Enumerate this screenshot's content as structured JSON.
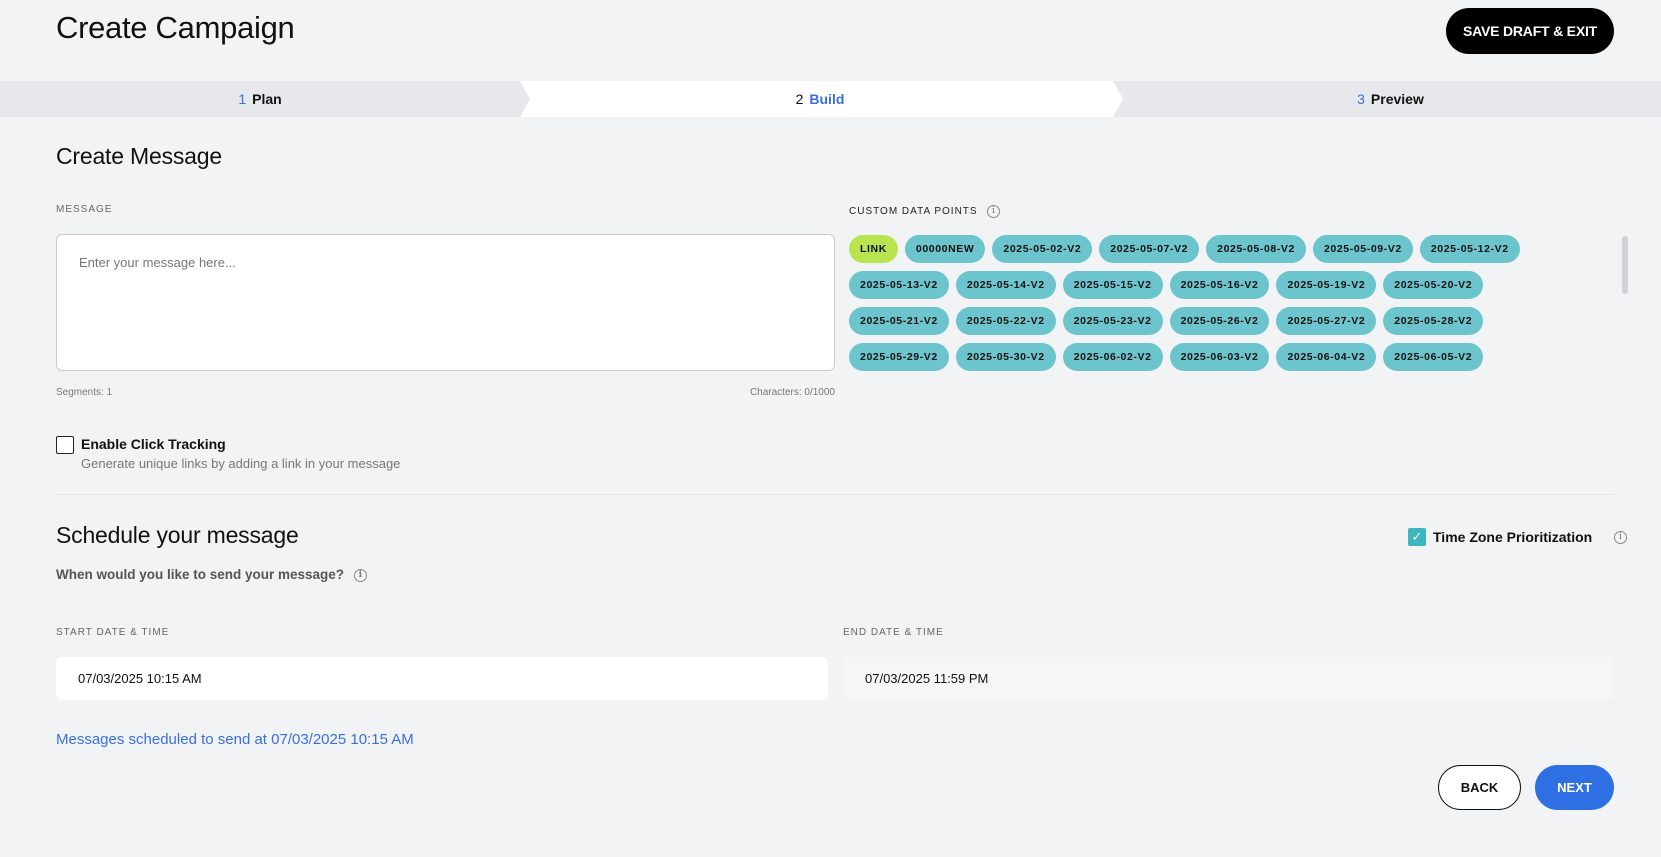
{
  "header": {
    "title": "Create Campaign",
    "save_label": "SAVE DRAFT & EXIT"
  },
  "stepper": {
    "steps": [
      {
        "num": "1",
        "label": "Plan"
      },
      {
        "num": "2",
        "label": "Build"
      },
      {
        "num": "3",
        "label": "Preview"
      }
    ],
    "active": "Build"
  },
  "message": {
    "section_title": "Create Message",
    "label": "MESSAGE",
    "placeholder": "Enter your message here...",
    "segments": "Segments: 1",
    "characters": "Characters: 0/1000"
  },
  "custom_data_points": {
    "label": "CUSTOM DATA POINTS",
    "rows": [
      [
        "LINK",
        "00000NEW",
        "2025-05-02-V2",
        "2025-05-07-V2",
        "2025-05-08-V2",
        "2025-05-09-V2",
        "2025-05-12-V2"
      ],
      [
        "2025-05-13-V2",
        "2025-05-14-V2",
        "2025-05-15-V2",
        "2025-05-16-V2",
        "2025-05-19-V2",
        "2025-05-20-V2"
      ],
      [
        "2025-05-21-V2",
        "2025-05-22-V2",
        "2025-05-23-V2",
        "2025-05-26-V2",
        "2025-05-27-V2",
        "2025-05-28-V2"
      ],
      [
        "2025-05-29-V2",
        "2025-05-30-V2",
        "2025-06-02-V2",
        "2025-06-03-V2",
        "2025-06-04-V2",
        "2025-06-05-V2"
      ]
    ]
  },
  "click_tracking": {
    "checked": false,
    "title": "Enable Click Tracking",
    "subtitle": "Generate unique links by adding a link in your message"
  },
  "schedule": {
    "section_title": "Schedule your message",
    "question": "When would you like to send your message?",
    "tz_label": "Time Zone Prioritization",
    "tz_checked": true,
    "start_label": "START DATE & TIME",
    "start_value": "07/03/2025 10:15 AM",
    "end_label": "END DATE & TIME",
    "end_value": "07/03/2025 11:59 PM",
    "note": "Messages scheduled to send at 07/03/2025 10:15 AM"
  },
  "footer": {
    "back_label": "BACK",
    "next_label": "NEXT"
  },
  "colors": {
    "accent_blue": "#3b6fe0",
    "chip_teal": "#6cc5cc",
    "chip_link": "#b9e34f",
    "next_button": "#2f6fe4"
  }
}
